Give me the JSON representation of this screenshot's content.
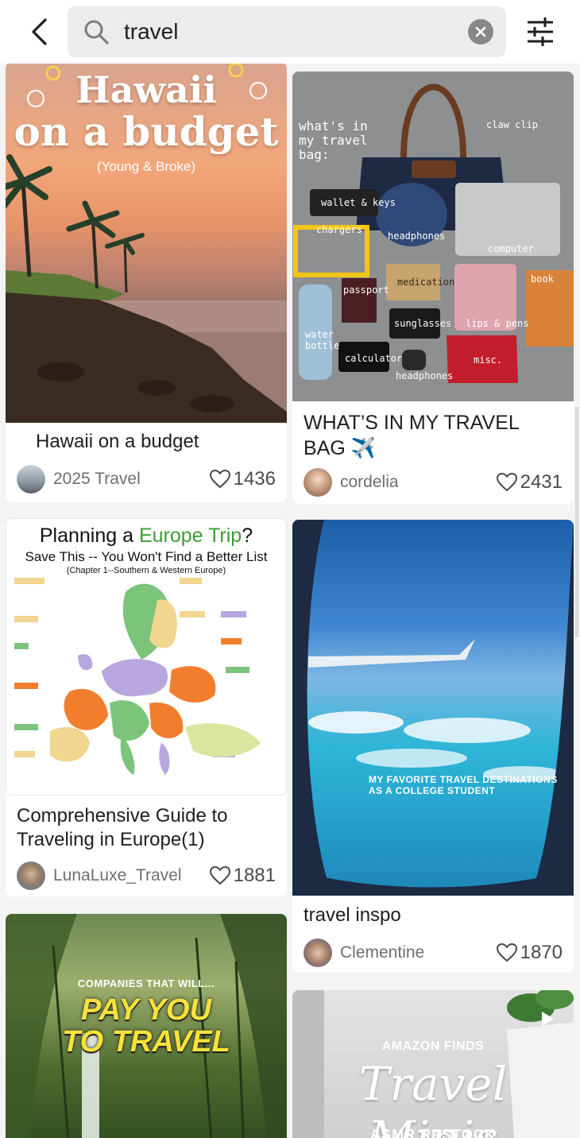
{
  "search": {
    "query": "travel"
  },
  "icons": {
    "back": "back-arrow-icon",
    "search": "search-icon",
    "clear": "clear-icon",
    "filter": "filter-sliders-icon",
    "like": "heart-icon",
    "play": "play-icon"
  },
  "colors": {
    "background": "#f4f4f4",
    "card": "#ffffff",
    "search_field": "#ececec",
    "europe_accent": "#3f9b36"
  },
  "posts": [
    {
      "title": "Hawaii on a budget",
      "author": "2025 Travel",
      "likes": "1436",
      "thumb": {
        "headline_1": "Hawaii",
        "headline_2": "on a budget",
        "subtitle": "(Young & Broke)"
      }
    },
    {
      "title": "WHAT’S IN MY TRAVEL BAG ✈️",
      "author": "cordelia",
      "likes": "2431",
      "thumb": {
        "headline": "what's in my travel bag:",
        "labels": [
          "claw clip",
          "wallet & keys",
          "chargers",
          "headphones",
          "computer",
          "passport",
          "medication",
          "book",
          "water bottle",
          "sunglasses",
          "lips & pens",
          "calculator",
          "misc.",
          "headphones"
        ]
      }
    },
    {
      "title": "Comprehensive Guide to Traveling in Europe(1)",
      "author": "LunaLuxe_Travel",
      "likes": "1881",
      "thumb": {
        "headline_prefix": "Planning a ",
        "headline_accent": "Europe Trip",
        "headline_suffix": "?",
        "subheadline": "Save This -- You Won't Find a Better List",
        "chapter": "(Chapter 1--Southern & Western Europe)"
      }
    },
    {
      "title": "travel inspo",
      "author": "Clementine",
      "likes": "1870",
      "thumb": {
        "caption_1": "MY FAVORITE TRAVEL DESTINATIONS",
        "caption_2": "AS A COLLEGE STUDENT"
      }
    },
    {
      "thumb": {
        "caption_small": "COMPANIES THAT WILL...",
        "caption_1": "PAY YOU",
        "caption_2": "TO TRAVEL"
      }
    },
    {
      "thumb": {
        "caption_small": "AMAZON FINDS",
        "caption_script": "Travel Minis",
        "caption_bottom": "ASMR RESTOCK"
      }
    }
  ]
}
